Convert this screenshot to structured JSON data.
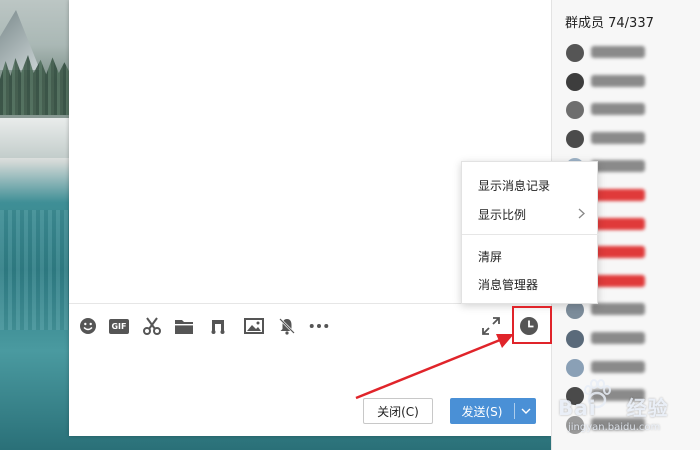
{
  "member_panel": {
    "title": "群成员 74/337",
    "members": [
      {
        "avatar_color": "#555555",
        "name_color": "#8a8a8a"
      },
      {
        "avatar_color": "#3d3d3d",
        "name_color": "#8a8a8a"
      },
      {
        "avatar_color": "#6e6e6e",
        "name_color": "#8a8a8a"
      },
      {
        "avatar_color": "#4b4b4b",
        "name_color": "#8a8a8a"
      },
      {
        "avatar_color": "#9fb4c8",
        "name_color": "#8a8a8a"
      },
      {
        "avatar_color": "#c7c7c7",
        "name_color": "#e03a3a"
      },
      {
        "avatar_color": "#a9bfd9",
        "name_color": "#e03a3a"
      },
      {
        "avatar_color": "#cfcfcf",
        "name_color": "#e03a3a"
      },
      {
        "avatar_color": "#b8b8b8",
        "name_color": "#e03a3a"
      },
      {
        "avatar_color": "#7c8c9a",
        "name_color": "#8a8a8a"
      },
      {
        "avatar_color": "#5a6a7a",
        "name_color": "#8a8a8a"
      },
      {
        "avatar_color": "#8aa0b6",
        "name_color": "#8a8a8a"
      },
      {
        "avatar_color": "#4a4a4a",
        "name_color": "#8a8a8a"
      },
      {
        "avatar_color": "#9a9a9a",
        "name_color": "#8a8a8a"
      }
    ]
  },
  "toolbar": {
    "icons": [
      "emoji-icon",
      "gif-icon",
      "screenshot-scissors-icon",
      "folder-icon",
      "music-icon",
      "image-icon",
      "mute-bell-icon",
      "more-icon"
    ],
    "gif_label": "GIF",
    "expand_icon": "expand-icon",
    "history_icon": "clock-icon"
  },
  "context_menu": {
    "items": [
      "显示消息记录",
      "显示比例",
      "清屏",
      "消息管理器"
    ]
  },
  "buttons": {
    "close_label": "关闭(C)",
    "send_label": "发送(S)"
  },
  "watermark": {
    "brand": "Bai",
    "brand_cn": "经验",
    "site": "jingyan.baidu.com"
  },
  "colors": {
    "accent": "#4a90d6",
    "annotation": "#e0242a"
  }
}
